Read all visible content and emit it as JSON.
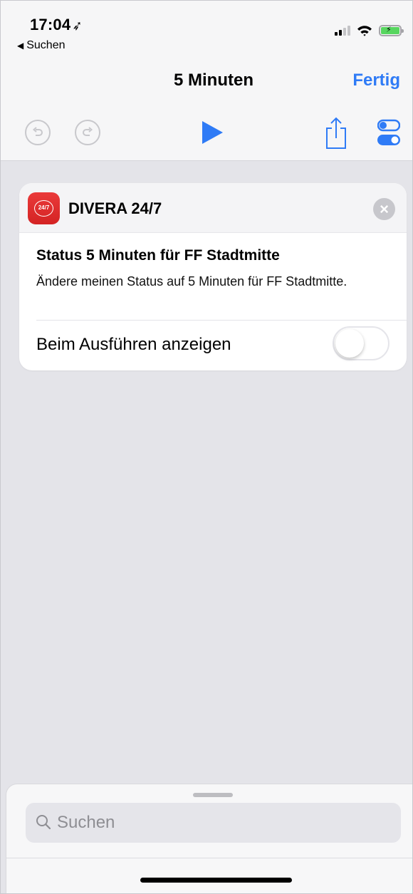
{
  "status_bar": {
    "time": "17:04",
    "location_arrow": "location-arrow-icon",
    "back_label": "Suchen",
    "icons": [
      "signal-icon",
      "wifi-icon",
      "battery-charging-icon"
    ]
  },
  "nav": {
    "title": "5 Minuten",
    "done_label": "Fertig"
  },
  "toolbar": {
    "icons": [
      "undo-icon",
      "redo-icon",
      "play-icon",
      "share-icon",
      "settings-toggles-icon"
    ]
  },
  "action_card": {
    "app_name": "DIVERA 24/7",
    "app_icon_text": "24/7",
    "title": "Status 5 Minuten für FF Stadtmitte",
    "description": "Ändere meinen Status auf 5 Minuten für FF Stadtmitte.",
    "show_when_run_label": "Beim Ausführen anzeigen",
    "show_when_run_enabled": false
  },
  "bottom_sheet": {
    "search_placeholder": "Suchen"
  },
  "colors": {
    "accent": "#2f7bf6",
    "app_red": "#e03030",
    "background": "#e4e4e9"
  }
}
